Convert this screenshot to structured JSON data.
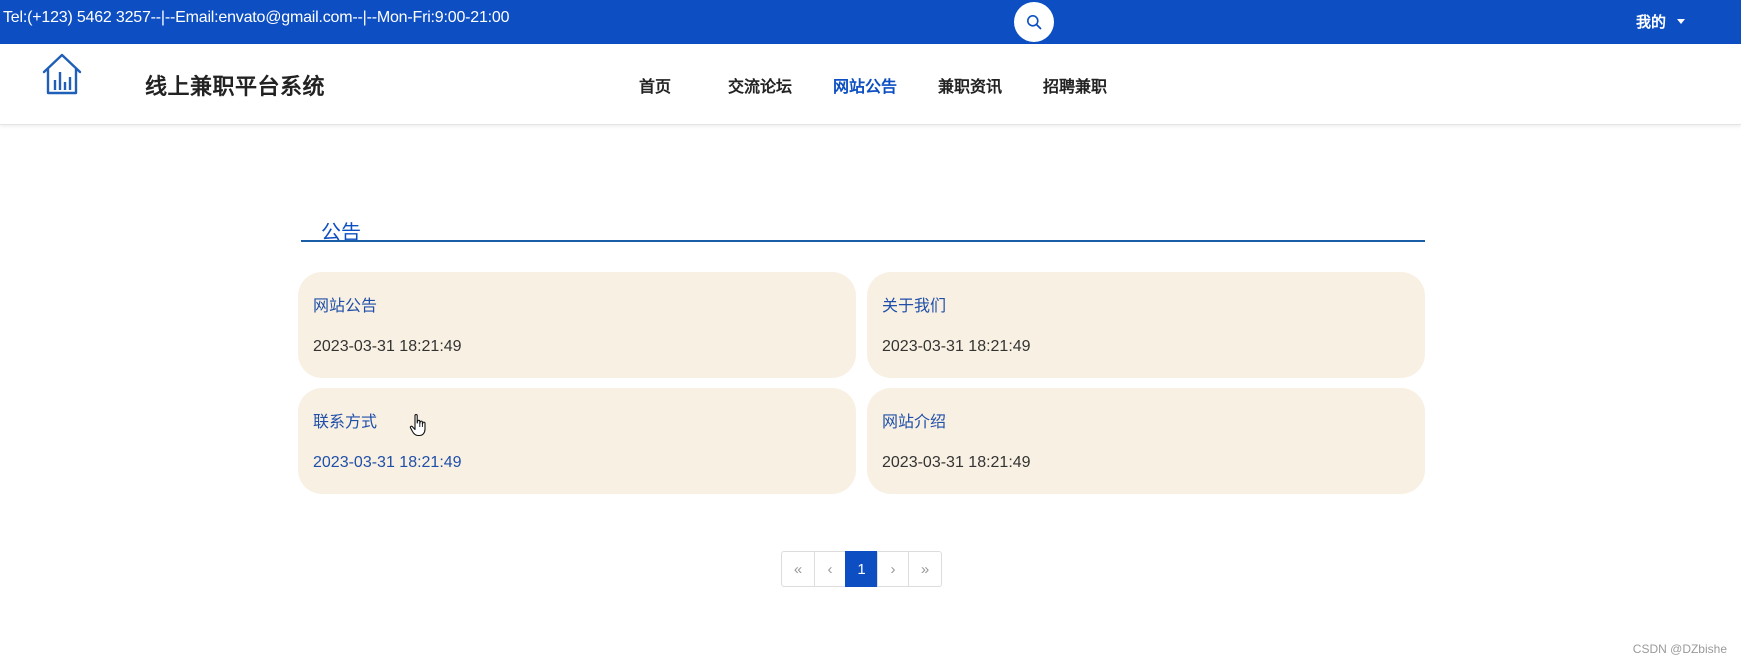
{
  "topbar": {
    "contact": "Tel:(+123) 5462 3257--|--Email:envato@gmail.com--|--Mon-Fri:9:00-21:00",
    "search_icon": "search-icon",
    "user_menu_label": "我的",
    "bg_color": "#0d4fc2"
  },
  "header": {
    "logo_icon": "house-chart-icon",
    "site_title": "线上兼职平台系统",
    "nav": [
      {
        "label": "首页",
        "active": false
      },
      {
        "label": "交流论坛",
        "active": false
      },
      {
        "label": "网站公告",
        "active": true
      },
      {
        "label": "兼职资讯",
        "active": false
      },
      {
        "label": "招聘兼职",
        "active": false
      }
    ]
  },
  "main": {
    "section_title": "公告",
    "notices": [
      {
        "title": "网站公告",
        "date": "2023-03-31 18:21:49"
      },
      {
        "title": "关于我们",
        "date": "2023-03-31 18:21:49"
      },
      {
        "title": "联系方式",
        "date": "2023-03-31 18:21:49"
      },
      {
        "title": "网站介绍",
        "date": "2023-03-31 18:21:49"
      }
    ],
    "card_color": "#f8f0e3",
    "accent_color": "#1f4fa8"
  },
  "pagination": {
    "first": "«",
    "prev": "‹",
    "current": "1",
    "next": "›",
    "last": "»"
  },
  "watermark": "CSDN @DZbishe"
}
